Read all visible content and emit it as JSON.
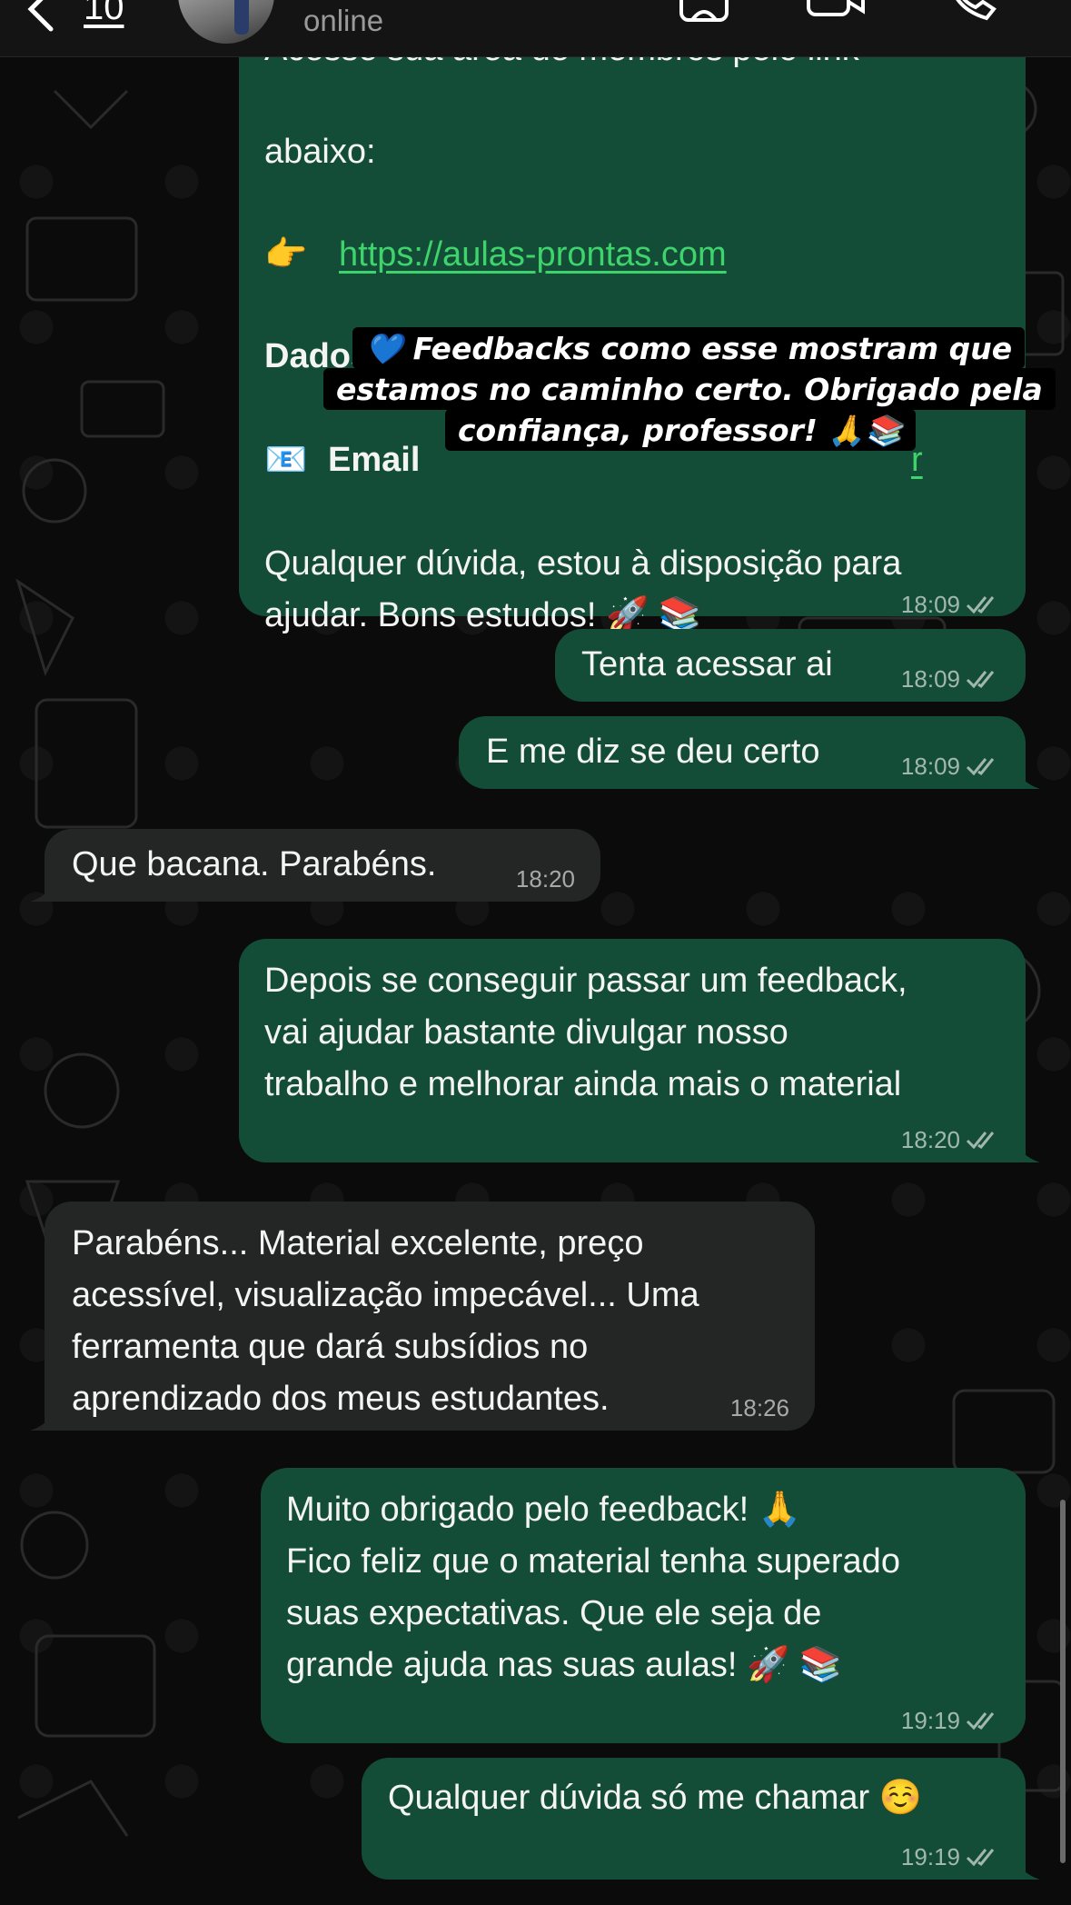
{
  "header": {
    "unread_count": "10",
    "status": "online",
    "icons": [
      "back-icon",
      "contact-icon",
      "video-call-icon",
      "phone-icon"
    ]
  },
  "messages": [
    {
      "direction": "outgoing",
      "lines": [
        "Acesse sua área de membros pelo link",
        "abaixo:"
      ],
      "link_prefix_emoji": "👉",
      "link": "https://aulas-prontas.com",
      "access_heading": "Dados de acesso:",
      "email_emoji": "📧",
      "email_label": "Email",
      "closing_lines": [
        "Qualquer dúvida, estou à disposição para",
        "ajudar. Bons estudos! 🚀 📚"
      ],
      "time": "18:09"
    },
    {
      "direction": "outgoing",
      "text": "Tenta acessar ai",
      "time": "18:09"
    },
    {
      "direction": "outgoing",
      "text": "E me diz se deu certo",
      "time": "18:09"
    },
    {
      "direction": "incoming",
      "text": "Que bacana. Parabéns.",
      "time": "18:20"
    },
    {
      "direction": "outgoing",
      "lines": [
        "Depois se conseguir passar um feedback,",
        "vai ajudar bastante divulgar nosso",
        "trabalho e melhorar ainda mais o material"
      ],
      "time": "18:20"
    },
    {
      "direction": "incoming",
      "lines": [
        "Parabéns... Material excelente, preço",
        "acessível, visualização impecável... Uma",
        "ferramenta que dará subsídios no",
        "aprendizado dos meus estudantes."
      ],
      "time": "18:26"
    },
    {
      "direction": "outgoing",
      "lines": [
        "Muito obrigado pelo feedback! 🙏",
        "Fico feliz que o material tenha superado",
        "suas expectativas. Que ele seja de",
        "grande ajuda nas suas aulas! 🚀 📚"
      ],
      "time": "19:19"
    },
    {
      "direction": "outgoing",
      "text": "Qualquer dúvida só me chamar ☺️",
      "time": "19:19"
    }
  ],
  "caption": {
    "lines": [
      "💙 Feedbacks como esse mostram que",
      "estamos no caminho certo. Obrigado pela",
      "confiança, professor! 🙏📚"
    ]
  },
  "colors": {
    "outgoing_bubble": "#144d37",
    "incoming_bubble": "#242626",
    "link": "#3ed46b",
    "background": "#0b0b0b"
  }
}
